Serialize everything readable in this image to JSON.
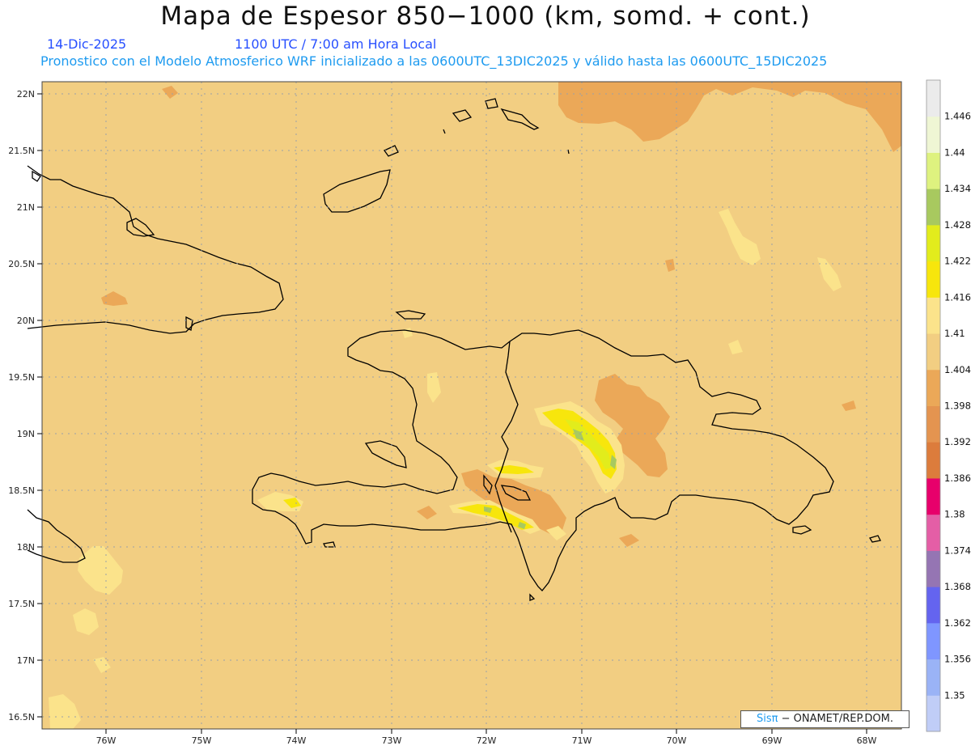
{
  "header": {
    "title": "Mapa de Espesor 850−1000 (km, somd. + cont.)",
    "date": "14-Dic-2025",
    "time": "1100 UTC / 7:00 am Hora Local",
    "model_line": "Pronostico con el Modelo Atmosferico WRF inicializado a las 0600UTC_13DIC2025 y válido hasta las  0600UTC_15DIC2025"
  },
  "credit": {
    "prefix": "Sisπ",
    "text": "− ONAMET/REP.DOM."
  },
  "map": {
    "lat_labels": [
      "22N",
      "21.5N",
      "21N",
      "20.5N",
      "20N",
      "19.5N",
      "19N",
      "18.5N",
      "18N",
      "17.5N",
      "17N",
      "16.5N"
    ],
    "lon_labels": [
      "76W",
      "75W",
      "74W",
      "73W",
      "72W",
      "71W",
      "70W",
      "69W",
      "68W"
    ],
    "background_value": 1.404,
    "background_color": "#f2ce82",
    "coastline_color": "#000000"
  },
  "colorbar": {
    "levels": [
      "1.35",
      "1.356",
      "1.362",
      "1.368",
      "1.374",
      "1.38",
      "1.386",
      "1.392",
      "1.398",
      "1.404",
      "1.41",
      "1.416",
      "1.422",
      "1.428",
      "1.434",
      "1.44",
      "1.446"
    ],
    "colors": [
      "#c0cdf7",
      "#9ab3f6",
      "#7f96ff",
      "#6464ef",
      "#9575b3",
      "#e45ea6",
      "#e7006b",
      "#dc7c3c",
      "#e49450",
      "#eba858",
      "#f2ce82",
      "#fbe38b",
      "#f7e60c",
      "#e2ec1c",
      "#a8c95f",
      "#def27f",
      "#eff6d4",
      "#ebebeb"
    ]
  }
}
